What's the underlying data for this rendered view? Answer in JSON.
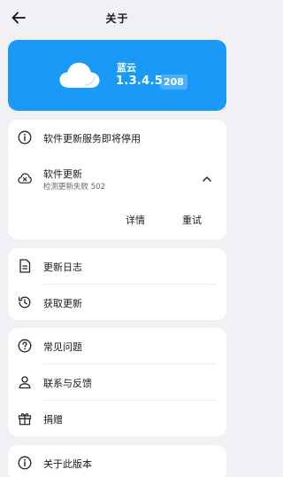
{
  "header": {
    "title": "关于",
    "back_icon": "arrow-left-icon"
  },
  "hero": {
    "app_name": "蓝云",
    "version": "1.3.4.5",
    "build": "208",
    "icon": "cloud-icon",
    "background_color": "#1a9af7"
  },
  "update_card": {
    "notice": {
      "label": "软件更新服务即将停用",
      "icon": "info-icon"
    },
    "update": {
      "label": "软件更新",
      "status": "检测更新失败 502",
      "icon": "cloud-error-icon",
      "expand_icon": "chevron-up-icon"
    },
    "actions": {
      "details": "详情",
      "retry": "重试"
    }
  },
  "log_card": {
    "items": [
      {
        "label": "更新日志",
        "icon": "document-icon"
      },
      {
        "label": "获取更新",
        "icon": "history-icon"
      }
    ]
  },
  "help_card": {
    "items": [
      {
        "label": "常见问题",
        "icon": "help-icon"
      },
      {
        "label": "联系与反馈",
        "icon": "person-icon"
      },
      {
        "label": "捐赠",
        "icon": "gift-icon"
      }
    ]
  },
  "about_card": {
    "items": [
      {
        "label": "关于此版本",
        "icon": "info-icon"
      }
    ]
  }
}
